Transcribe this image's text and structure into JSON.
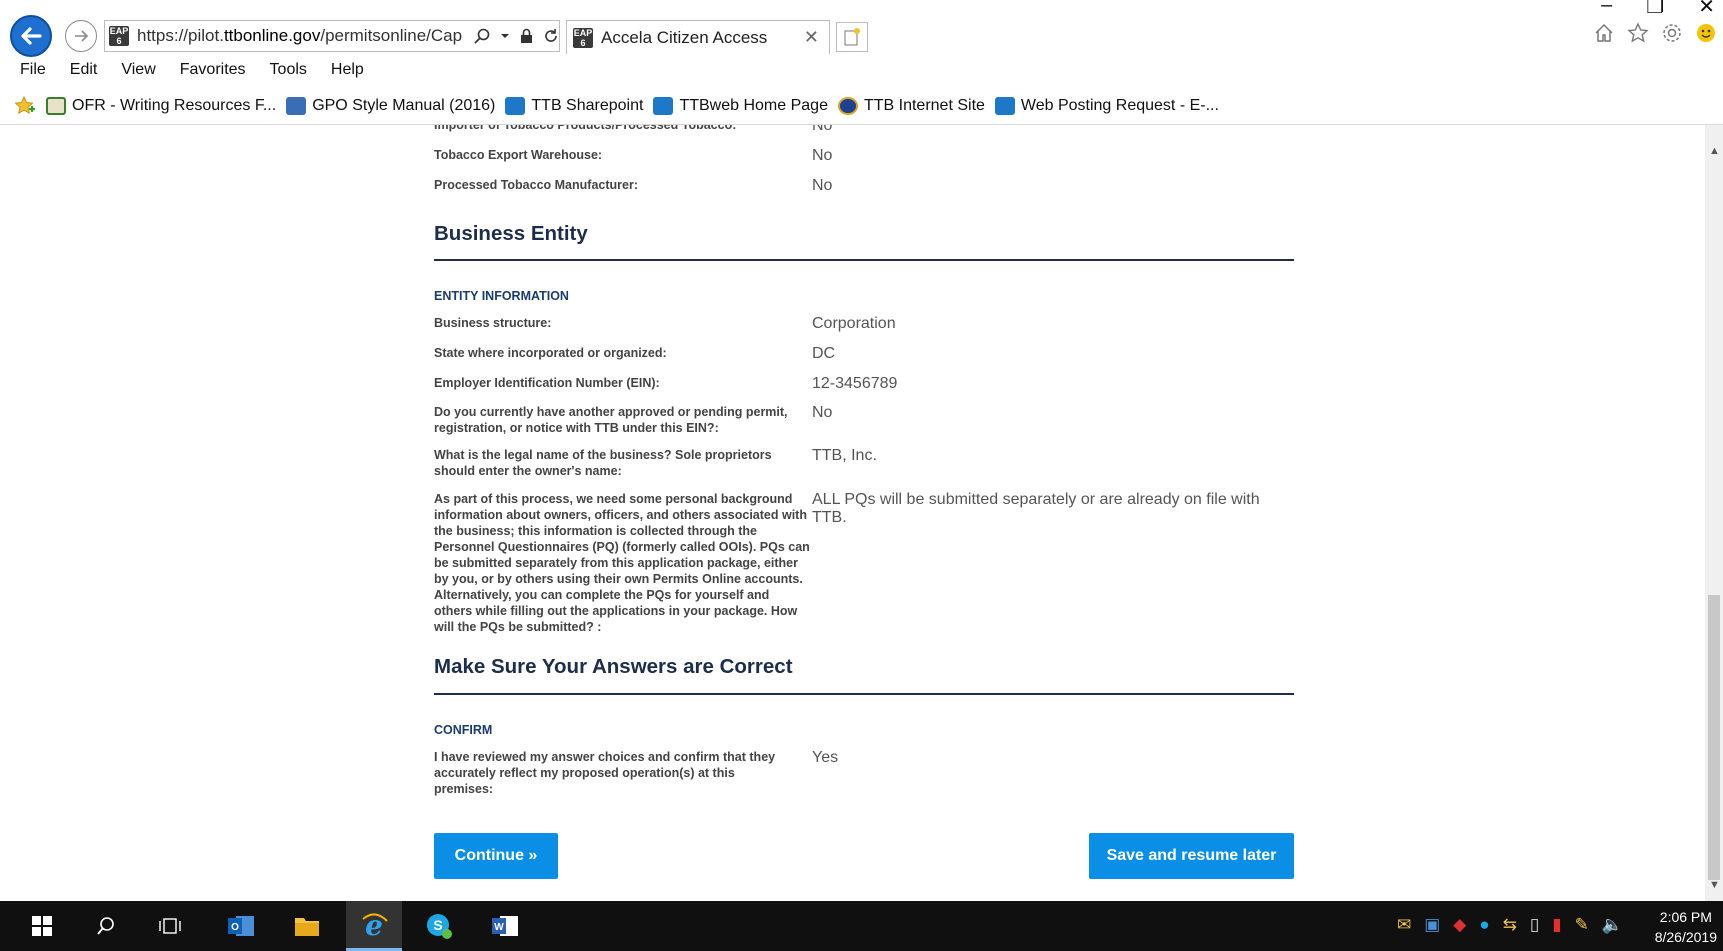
{
  "window": {
    "minimize_glyph": "–",
    "restore_glyph": "❐",
    "close_glyph": "✕"
  },
  "browser": {
    "url_prefix": "https://pilot.",
    "url_domain": "ttbonline.gov",
    "url_path": "/permitsonline/Cap",
    "tab_title": "Accela Citizen Access",
    "favicon_text": "EAP 6",
    "menu": [
      "File",
      "Edit",
      "View",
      "Favorites",
      "Tools",
      "Help"
    ],
    "favorites": [
      {
        "label": "OFR - Writing Resources F...",
        "icon": "document-icon",
        "color": "#3a7d2f"
      },
      {
        "label": "GPO Style Manual (2016)",
        "icon": "gpo-icon",
        "color": "#3b6db5"
      },
      {
        "label": "TTB Sharepoint",
        "icon": "sharepoint-icon",
        "color": "#1e78c8"
      },
      {
        "label": "TTBweb Home Page",
        "icon": "sharepoint-icon",
        "color": "#1e78c8"
      },
      {
        "label": "TTB Internet Site",
        "icon": "seal-icon",
        "color": "#1f3f8f"
      },
      {
        "label": "Web Posting Request - E-...",
        "icon": "sharepoint-icon",
        "color": "#1e78c8"
      }
    ]
  },
  "page": {
    "top_rows": [
      {
        "label": "Importer of Tobacco Products/Processed Tobacco:",
        "value": "No"
      },
      {
        "label": "Tobacco Export Warehouse:",
        "value": "No"
      },
      {
        "label": "Processed Tobacco Manufacturer:",
        "value": "No"
      }
    ],
    "business_entity": {
      "title": "Business Entity",
      "subheader": "ENTITY INFORMATION",
      "rows": [
        {
          "label": "Business structure:",
          "value": "Corporation"
        },
        {
          "label": "State where incorporated or organized:",
          "value": "DC"
        },
        {
          "label": "Employer Identification Number (EIN):",
          "value": "12-3456789"
        },
        {
          "label": "Do you currently have another approved or pending permit, registration, or notice with TTB under this EIN?:",
          "value": "No"
        },
        {
          "label": "What is the legal name of the business? Sole proprietors should enter the owner's name:",
          "value": "TTB, Inc."
        },
        {
          "label": "As part of this process, we need some personal background information about owners, officers, and others associated with the business; this information is collected through the Personnel Questionnaires (PQ) (formerly called OOIs). PQs can be submitted separately from this application package, either by you, or by others using their own Permits Online accounts. Alternatively, you can complete the PQs for yourself and others while filling out the applications in your package. How will the PQs be submitted? :",
          "value": "ALL PQs will be submitted separately or are already on file with TTB."
        }
      ]
    },
    "confirm_section": {
      "title": "Make Sure Your Answers are Correct",
      "subheader": "CONFIRM",
      "rows": [
        {
          "label": "I have reviewed my answer choices and confirm that they accurately reflect my proposed operation(s) at this premises:",
          "value": "Yes"
        }
      ]
    },
    "buttons": {
      "continue": "Continue »",
      "save": "Save and resume later"
    }
  },
  "taskbar": {
    "time": "2:06 PM",
    "date": "8/26/2019"
  }
}
